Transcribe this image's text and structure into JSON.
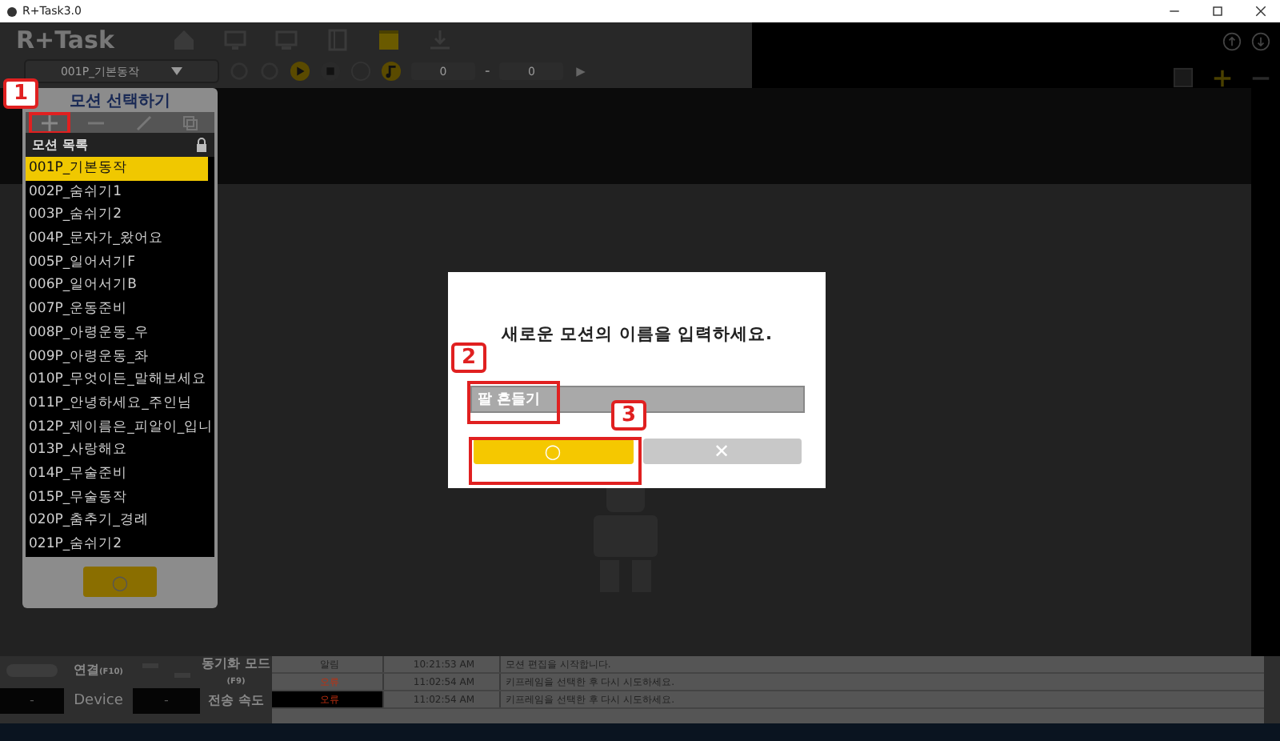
{
  "window": {
    "title": "R+Task3.0"
  },
  "app": {
    "logo": "R+Task"
  },
  "toolbar": {
    "motion_dropdown": "001P_기본동작",
    "start_value": "0",
    "separator": "-",
    "end_value": "0"
  },
  "motion_panel": {
    "title": "모션 선택하기",
    "list_header": "모션 목록",
    "confirm_label": "○",
    "items": [
      {
        "label": "001P_기본동작",
        "selected": true
      },
      {
        "label": "002P_숨쉬기1",
        "selected": false
      },
      {
        "label": "003P_숨쉬기2",
        "selected": false
      },
      {
        "label": "004P_문자가_왔어요",
        "selected": false
      },
      {
        "label": "005P_일어서기F",
        "selected": false
      },
      {
        "label": "006P_일어서기B",
        "selected": false
      },
      {
        "label": "007P_운동준비",
        "selected": false
      },
      {
        "label": "008P_아령운동_우",
        "selected": false
      },
      {
        "label": "009P_아령운동_좌",
        "selected": false
      },
      {
        "label": "010P_무엇이든_말해보세요",
        "selected": false
      },
      {
        "label": "011P_안녕하세요_주인님",
        "selected": false
      },
      {
        "label": "012P_제이름은_피알이_입니",
        "selected": false
      },
      {
        "label": "013P_사랑해요",
        "selected": false
      },
      {
        "label": "014P_무술준비",
        "selected": false
      },
      {
        "label": "015P_무술동작",
        "selected": false
      },
      {
        "label": "020P_춤추기_경례",
        "selected": false
      },
      {
        "label": "021P_숨쉬기2",
        "selected": false
      }
    ]
  },
  "dialog": {
    "message": "새로운 모션의 이름을 입력하세요.",
    "name_value": "팔 흔들기",
    "ok_label": "○",
    "cancel_label": "✕"
  },
  "callouts": [
    {
      "number": "1"
    },
    {
      "number": "2"
    },
    {
      "number": "3"
    }
  ],
  "status": {
    "connect_label": "연결",
    "connect_key": "(F10)",
    "sync_label": "동기화 모드",
    "sync_key": "(F9)",
    "device_value": "-",
    "device_label": "Device",
    "speed_value": "-",
    "speed_label": "전송 속도"
  },
  "log": {
    "rows": [
      {
        "level": "알림",
        "kind": "info",
        "time": "10:21:53 AM",
        "message": "모션 편집을 시작합니다.",
        "selected": false
      },
      {
        "level": "오류",
        "kind": "error",
        "time": "11:02:54 AM",
        "message": "키프레임을 선택한 후 다시 시도하세요.",
        "selected": false
      },
      {
        "level": "오류",
        "kind": "error",
        "time": "11:02:54 AM",
        "message": "키프레임을 선택한 후 다시 시도하세요.",
        "selected": true
      }
    ]
  }
}
